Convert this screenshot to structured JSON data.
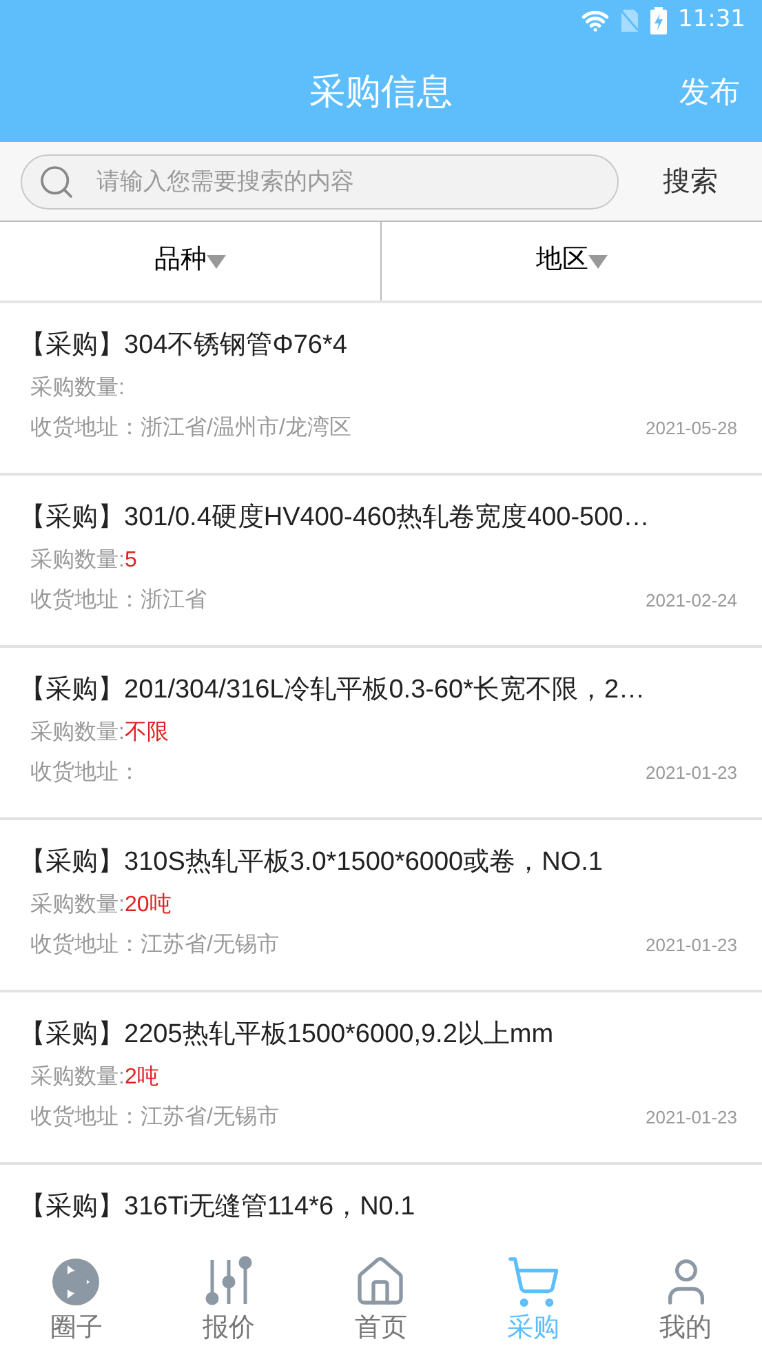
{
  "status_bar": {
    "time": "11:31"
  },
  "header": {
    "title": "采购信息",
    "action": "发布"
  },
  "search": {
    "placeholder": "请输入您需要搜索的内容",
    "button": "搜索"
  },
  "filters": [
    {
      "label": "品种"
    },
    {
      "label": "地区"
    }
  ],
  "items": [
    {
      "title": "【采购】304不锈钢管Φ76*4",
      "quantity_label": "采购数量:",
      "address": "收货地址：浙江省/温州市/龙湾区",
      "date": "2021-05-28"
    },
    {
      "title": "【采购】301/0.4硬度HV400-460热轧卷宽度400-500…",
      "quantity_label": "采购数量:",
      "quantity": "5",
      "address": "收货地址：浙江省",
      "date": "2021-02-24"
    },
    {
      "title": "【采购】201/304/316L冷轧平板0.3-60*长宽不限，2…",
      "quantity_label": "采购数量:",
      "quantity": "不限",
      "address": "收货地址：",
      "date": "2021-01-23"
    },
    {
      "title": "【采购】310S热轧平板3.0*1500*6000或卷，NO.1",
      "quantity_label": "采购数量:",
      "quantity": "20吨",
      "address": "收货地址：江苏省/无锡市",
      "date": "2021-01-23"
    },
    {
      "title": "【采购】2205热轧平板1500*6000,9.2以上mm",
      "quantity_label": "采购数量:",
      "quantity": "2吨",
      "address": "收货地址：江苏省/无锡市",
      "date": "2021-01-23"
    },
    {
      "title": "【采购】316Ti无缝管114*6，N0.1"
    }
  ],
  "nav": [
    {
      "label": "圈子",
      "kind": "circle",
      "selected": false
    },
    {
      "label": "报价",
      "kind": "sliders",
      "selected": false
    },
    {
      "label": "首页",
      "kind": "home",
      "selected": false
    },
    {
      "label": "采购",
      "kind": "cart",
      "selected": true
    },
    {
      "label": "我的",
      "kind": "user",
      "selected": false
    }
  ]
}
